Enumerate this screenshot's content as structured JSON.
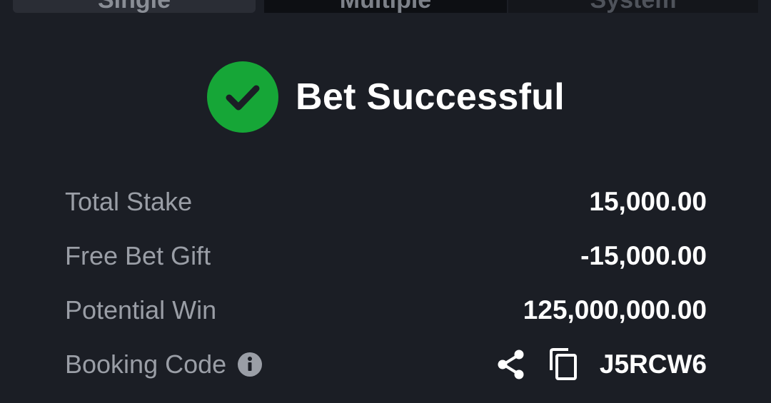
{
  "tabs": [
    {
      "label": "Single"
    },
    {
      "label": "Multiple"
    },
    {
      "label": "System"
    }
  ],
  "status": {
    "title": "Bet Successful",
    "icon": "check-circle-icon",
    "color": "#16a637"
  },
  "summary": {
    "total_stake": {
      "label": "Total Stake",
      "value": "15,000.00"
    },
    "free_bet_gift": {
      "label": "Free Bet Gift",
      "value": "-15,000.00"
    },
    "potential_win": {
      "label": "Potential Win",
      "value": "125,000,000.00"
    },
    "booking_code": {
      "label": "Booking Code",
      "value": "J5RCW6",
      "info_icon": "info-icon",
      "share_icon": "share-icon",
      "copy_icon": "copy-icon"
    }
  }
}
